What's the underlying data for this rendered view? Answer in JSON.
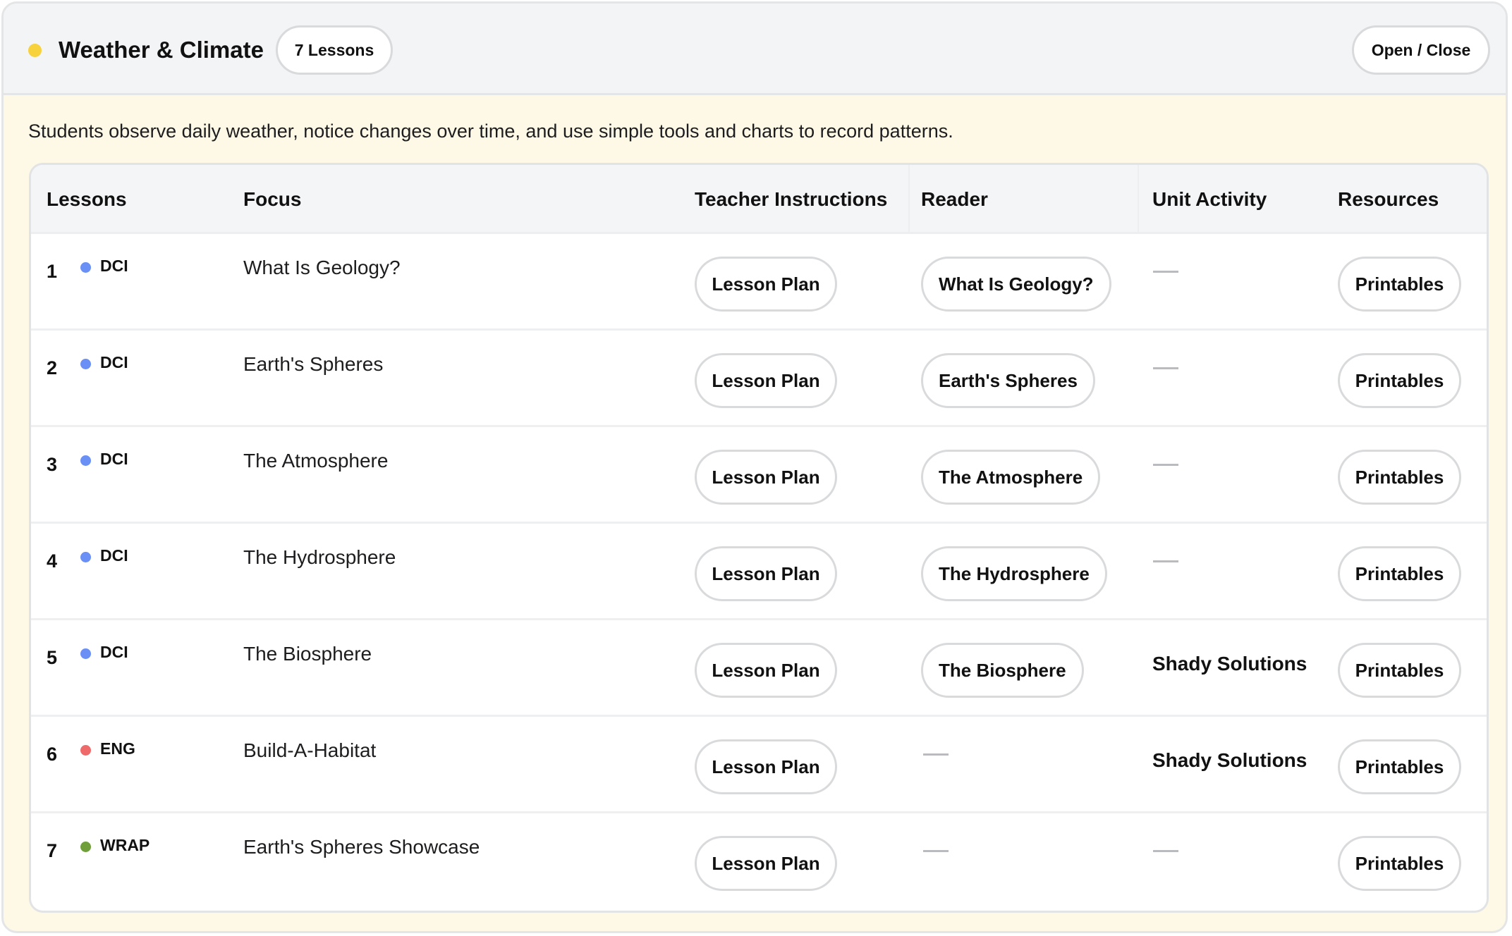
{
  "header": {
    "dot_color": "#f7d23c",
    "title": "Weather & Climate",
    "lesson_count": "7 Lessons",
    "toggle_label": "Open / Close"
  },
  "description": "Students observe daily weather, notice changes over time, and use simple tools and charts to record patterns.",
  "table": {
    "columns": [
      "Lessons",
      "Focus",
      "Teacher Instructions",
      "Reader",
      "Unit Activity",
      "Resources"
    ],
    "rows": [
      {
        "num": "1",
        "tag": "DCI",
        "tag_color": "#6a8ff5",
        "focus": "What Is Geology?",
        "teacher": "Lesson Plan",
        "reader": "What Is Geology?",
        "unit": null,
        "resources": "Printables"
      },
      {
        "num": "2",
        "tag": "DCI",
        "tag_color": "#6a8ff5",
        "focus": "Earth's Spheres",
        "teacher": "Lesson Plan",
        "reader": "Earth's Spheres",
        "unit": null,
        "resources": "Printables"
      },
      {
        "num": "3",
        "tag": "DCI",
        "tag_color": "#6a8ff5",
        "focus": "The Atmosphere",
        "teacher": "Lesson Plan",
        "reader": "The Atmosphere",
        "unit": null,
        "resources": "Printables"
      },
      {
        "num": "4",
        "tag": "DCI",
        "tag_color": "#6a8ff5",
        "focus": "The Hydrosphere",
        "teacher": "Lesson Plan",
        "reader": "The Hydrosphere",
        "unit": null,
        "resources": "Printables"
      },
      {
        "num": "5",
        "tag": "DCI",
        "tag_color": "#6a8ff5",
        "focus": "The Biosphere",
        "teacher": "Lesson Plan",
        "reader": "The Biosphere",
        "unit": "Shady Solutions",
        "resources": "Printables"
      },
      {
        "num": "6",
        "tag": "ENG",
        "tag_color": "#ef6b6b",
        "focus": "Build-A-Habitat",
        "teacher": "Lesson Plan",
        "reader": null,
        "unit": "Shady Solutions",
        "resources": "Printables"
      },
      {
        "num": "7",
        "tag": "WRAP",
        "tag_color": "#6f9e3a",
        "focus": "Earth's Spheres Showcase",
        "teacher": "Lesson Plan",
        "reader": null,
        "unit": null,
        "resources": "Printables"
      }
    ]
  }
}
